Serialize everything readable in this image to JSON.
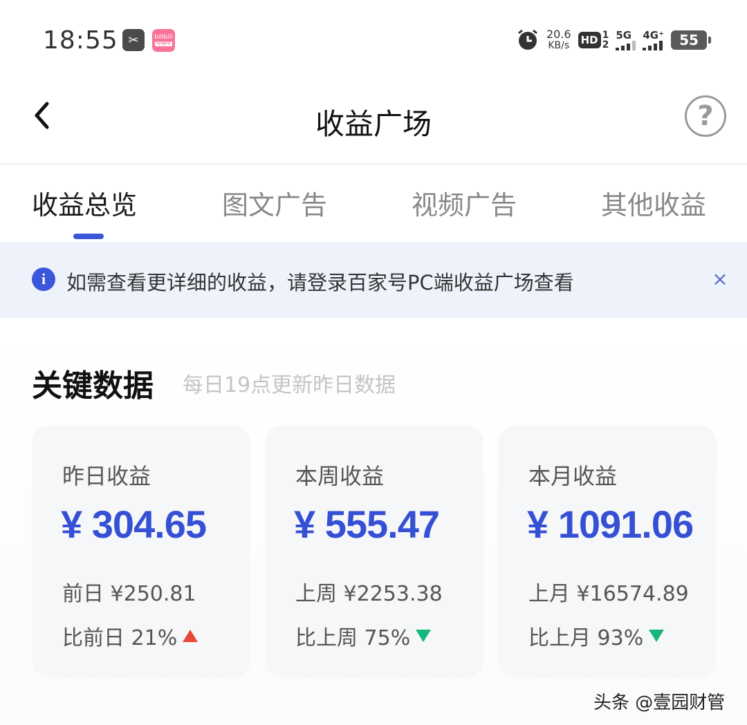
{
  "status_bar": {
    "time": "18:55",
    "app1_icon": "scissors-app-icon",
    "app2_icon": "bilibili-app-icon",
    "app2_text": "bilibili",
    "app2_sub": "哔哩哔",
    "net_speed_value": "20.6",
    "net_speed_unit": "KB/s",
    "hd_label": "HD",
    "hd_nums": [
      "1",
      "2"
    ],
    "sig1_label": "5G",
    "sig2_label": "4G⁺",
    "battery": "55"
  },
  "header": {
    "title": "收益广场",
    "back_icon": "chevron-left-icon",
    "help_label": "?"
  },
  "tabs": [
    {
      "label": "收益总览",
      "active": true
    },
    {
      "label": "图文广告",
      "active": false
    },
    {
      "label": "视频广告",
      "active": false
    },
    {
      "label": "其他收益",
      "active": false
    }
  ],
  "notice": {
    "icon": "i",
    "text": "如需查看更详细的收益，请登录百家号PC端收益广场查看",
    "close": "×"
  },
  "section": {
    "title": "关键数据",
    "subtitle": "每日19点更新昨日数据"
  },
  "cards": [
    {
      "label": "昨日收益",
      "amount": "¥ 304.65",
      "prev": "前日 ¥250.81",
      "compare": "比前日 21%",
      "trend": "up"
    },
    {
      "label": "本周收益",
      "amount": "¥ 555.47",
      "prev": "上周 ¥2253.38",
      "compare": "比上周 75%",
      "trend": "down"
    },
    {
      "label": "本月收益",
      "amount": "¥ 1091.06",
      "prev": "上月 ¥16574.89",
      "compare": "比上月 93%",
      "trend": "down"
    }
  ],
  "colors": {
    "accent": "#3b57d9",
    "amount": "#3550d4",
    "up": "#e8453c",
    "down": "#17b67a",
    "notice_bg": "#eef3fb"
  },
  "watermark": "头条 @壹园财管"
}
